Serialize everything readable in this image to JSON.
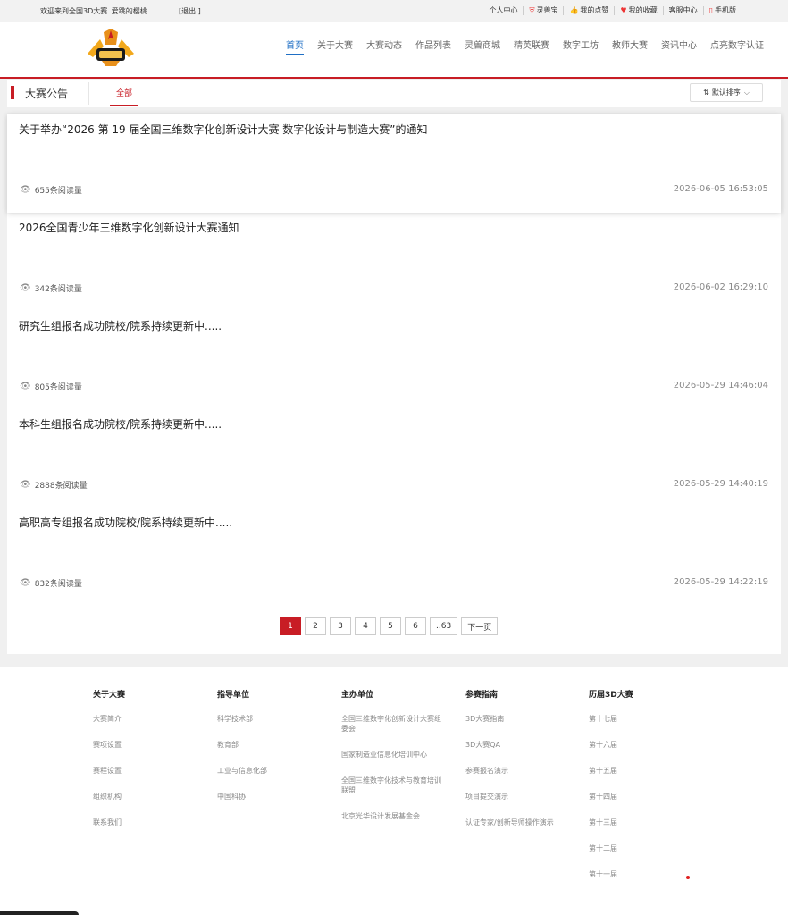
{
  "topbar": {
    "welcome": "欢迎来到全国3D大赛",
    "username": "爱跳的樱桃",
    "logout": "[退出 ]",
    "links": [
      {
        "label": "个人中心",
        "icon": ""
      },
      {
        "label": "灵兽宝",
        "icon": "shield-icon"
      },
      {
        "label": "我的点赞",
        "icon": "thumb-up-icon"
      },
      {
        "label": "我的收藏",
        "icon": "heart-icon"
      },
      {
        "label": "客服中心",
        "icon": ""
      },
      {
        "label": "手机版",
        "icon": "phone-icon"
      }
    ]
  },
  "nav": [
    "首页",
    "关于大赛",
    "大赛动态",
    "作品列表",
    "灵兽商城",
    "精英联赛",
    "数字工坊",
    "教师大赛",
    "资讯中心",
    "点亮数字认证"
  ],
  "nav_active": "首页",
  "panel": {
    "title": "大赛公告",
    "tab": "全部",
    "sort": "默认排序"
  },
  "items": [
    {
      "title": "关于举办“2026 第 19 届全国三维数字化创新设计大赛 数字化设计与制造大赛”的通知",
      "views": "655条阅读量",
      "date": "2026-06-05 16:53:05"
    },
    {
      "title": "2026全国青少年三维数字化创新设计大赛通知",
      "views": "342条阅读量",
      "date": "2026-06-02 16:29:10"
    },
    {
      "title": "研究生组报名成功院校/院系持续更新中.....",
      "views": "805条阅读量",
      "date": "2026-05-29 14:46:04"
    },
    {
      "title": "本科生组报名成功院校/院系持续更新中.....",
      "views": "2888条阅读量",
      "date": "2026-05-29 14:40:19"
    },
    {
      "title": "高职高专组报名成功院校/院系持续更新中.....",
      "views": "832条阅读量",
      "date": "2026-05-29 14:22:19"
    }
  ],
  "pager": [
    "1",
    "2",
    "3",
    "4",
    "5",
    "6",
    "..63",
    "下一页"
  ],
  "footer": {
    "columns": [
      {
        "heading": "关于大赛",
        "items": [
          "大赛简介",
          "赛项设置",
          "赛程设置",
          "组织机构",
          "联系我们"
        ]
      },
      {
        "heading": "指导单位",
        "items": [
          "科学技术部",
          "教育部",
          "工业与信息化部",
          "中国科协"
        ]
      },
      {
        "heading": "主办单位",
        "items": [
          "全国三维数字化创新设计大赛组委会",
          "国家制造业信息化培训中心",
          "全国三维数字化技术与教育培训联盟",
          "北京光华设计发展基金会"
        ]
      },
      {
        "heading": "参赛指南",
        "items": [
          "3D大赛指南",
          "3D大赛QA",
          "参赛报名演示",
          "项目提交演示",
          "认证专家/创新导师操作演示"
        ]
      },
      {
        "heading": "历届3D大赛",
        "items": [
          "第十七届",
          "第十六届",
          "第十五届",
          "第十四届",
          "第十三届",
          "第十二届",
          "第十一届"
        ]
      }
    ]
  }
}
